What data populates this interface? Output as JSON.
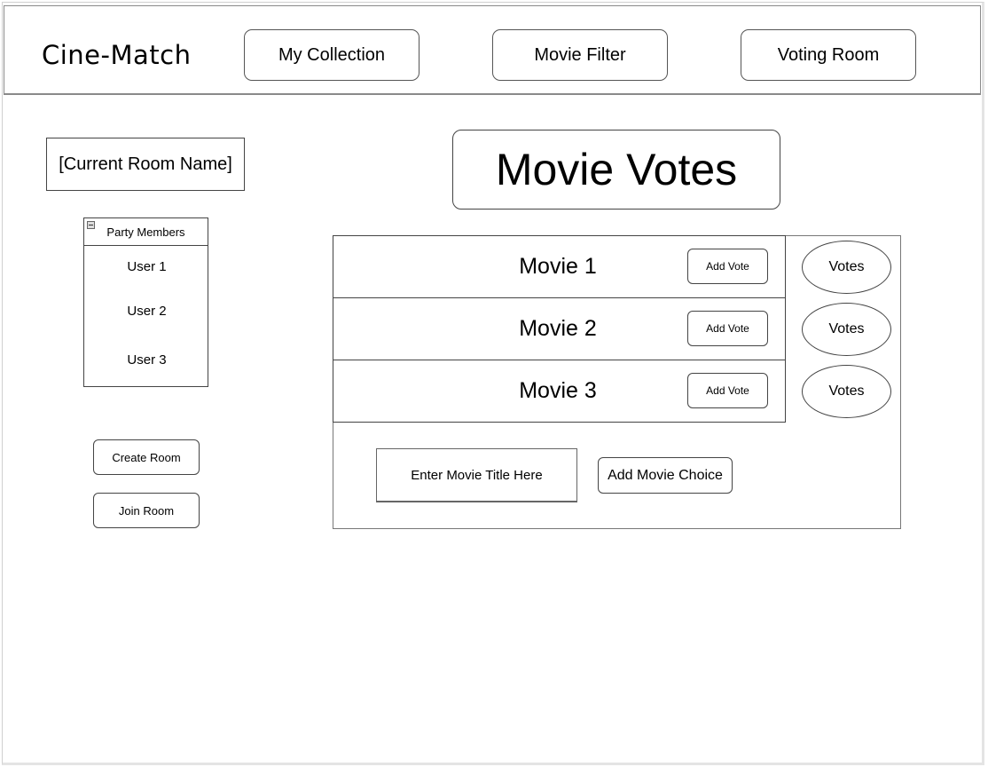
{
  "header": {
    "brand": "Cine-Match",
    "nav": [
      "My Collection",
      "Movie Filter",
      "Voting Room"
    ]
  },
  "room": {
    "name": "[Current Room Name]",
    "party_title": "Party Members",
    "members": [
      "User 1",
      "User 2",
      "User 3"
    ],
    "create_label": "Create Room",
    "join_label": "Join Room"
  },
  "main": {
    "title": "Movie Votes",
    "movies": [
      {
        "name": "Movie 1",
        "add_vote": "Add Vote",
        "votes": "Votes"
      },
      {
        "name": "Movie 2",
        "add_vote": "Add Vote",
        "votes": "Votes"
      },
      {
        "name": "Movie 3",
        "add_vote": "Add Vote",
        "votes": "Votes"
      }
    ],
    "input_placeholder": "Enter Movie Title Here",
    "add_choice_label": "Add Movie Choice"
  }
}
